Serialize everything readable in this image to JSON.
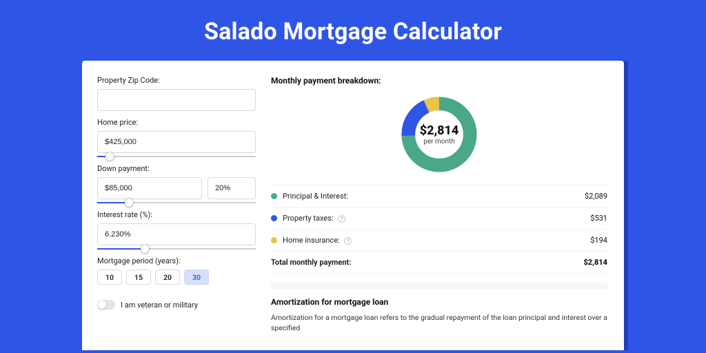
{
  "page_title": "Salado Mortgage Calculator",
  "form": {
    "zip_label": "Property Zip Code:",
    "zip_value": "",
    "home_price_label": "Home price:",
    "home_price_value": "$425,000",
    "home_price_slider_pct": 8,
    "down_payment_label": "Down payment:",
    "down_payment_value": "$85,000",
    "down_payment_pct_value": "20%",
    "down_payment_slider_pct": 20,
    "interest_label": "Interest rate (%):",
    "interest_value": "6.230%",
    "interest_slider_pct": 30,
    "period_label": "Mortgage period (years):",
    "period_options": [
      "10",
      "15",
      "20",
      "30"
    ],
    "period_selected": "30",
    "veteran_label": "I am veteran or military",
    "veteran_on": false
  },
  "breakdown": {
    "title": "Monthly payment breakdown:",
    "center_amount": "$2,814",
    "center_sub": "per month",
    "items": [
      {
        "color": "green",
        "label": "Principal & Interest:",
        "value": "$2,089",
        "help": false
      },
      {
        "color": "blue",
        "label": "Property taxes:",
        "value": "$531",
        "help": true
      },
      {
        "color": "yellow",
        "label": "Home insurance:",
        "value": "$194",
        "help": true
      }
    ],
    "total_label": "Total monthly payment:",
    "total_value": "$2,814"
  },
  "amortization": {
    "title": "Amortization for mortgage loan",
    "text": "Amortization for a mortgage loan refers to the gradual repayment of the loan principal and interest over a specified"
  },
  "chart_data": {
    "type": "pie",
    "title": "Monthly payment breakdown",
    "series": [
      {
        "name": "Principal & Interest",
        "value": 2089,
        "color": "#4aa789"
      },
      {
        "name": "Property taxes",
        "value": 531,
        "color": "#2f55e7"
      },
      {
        "name": "Home insurance",
        "value": 194,
        "color": "#e7c44a"
      }
    ],
    "total": 2814,
    "center_label": "$2,814 per month"
  }
}
